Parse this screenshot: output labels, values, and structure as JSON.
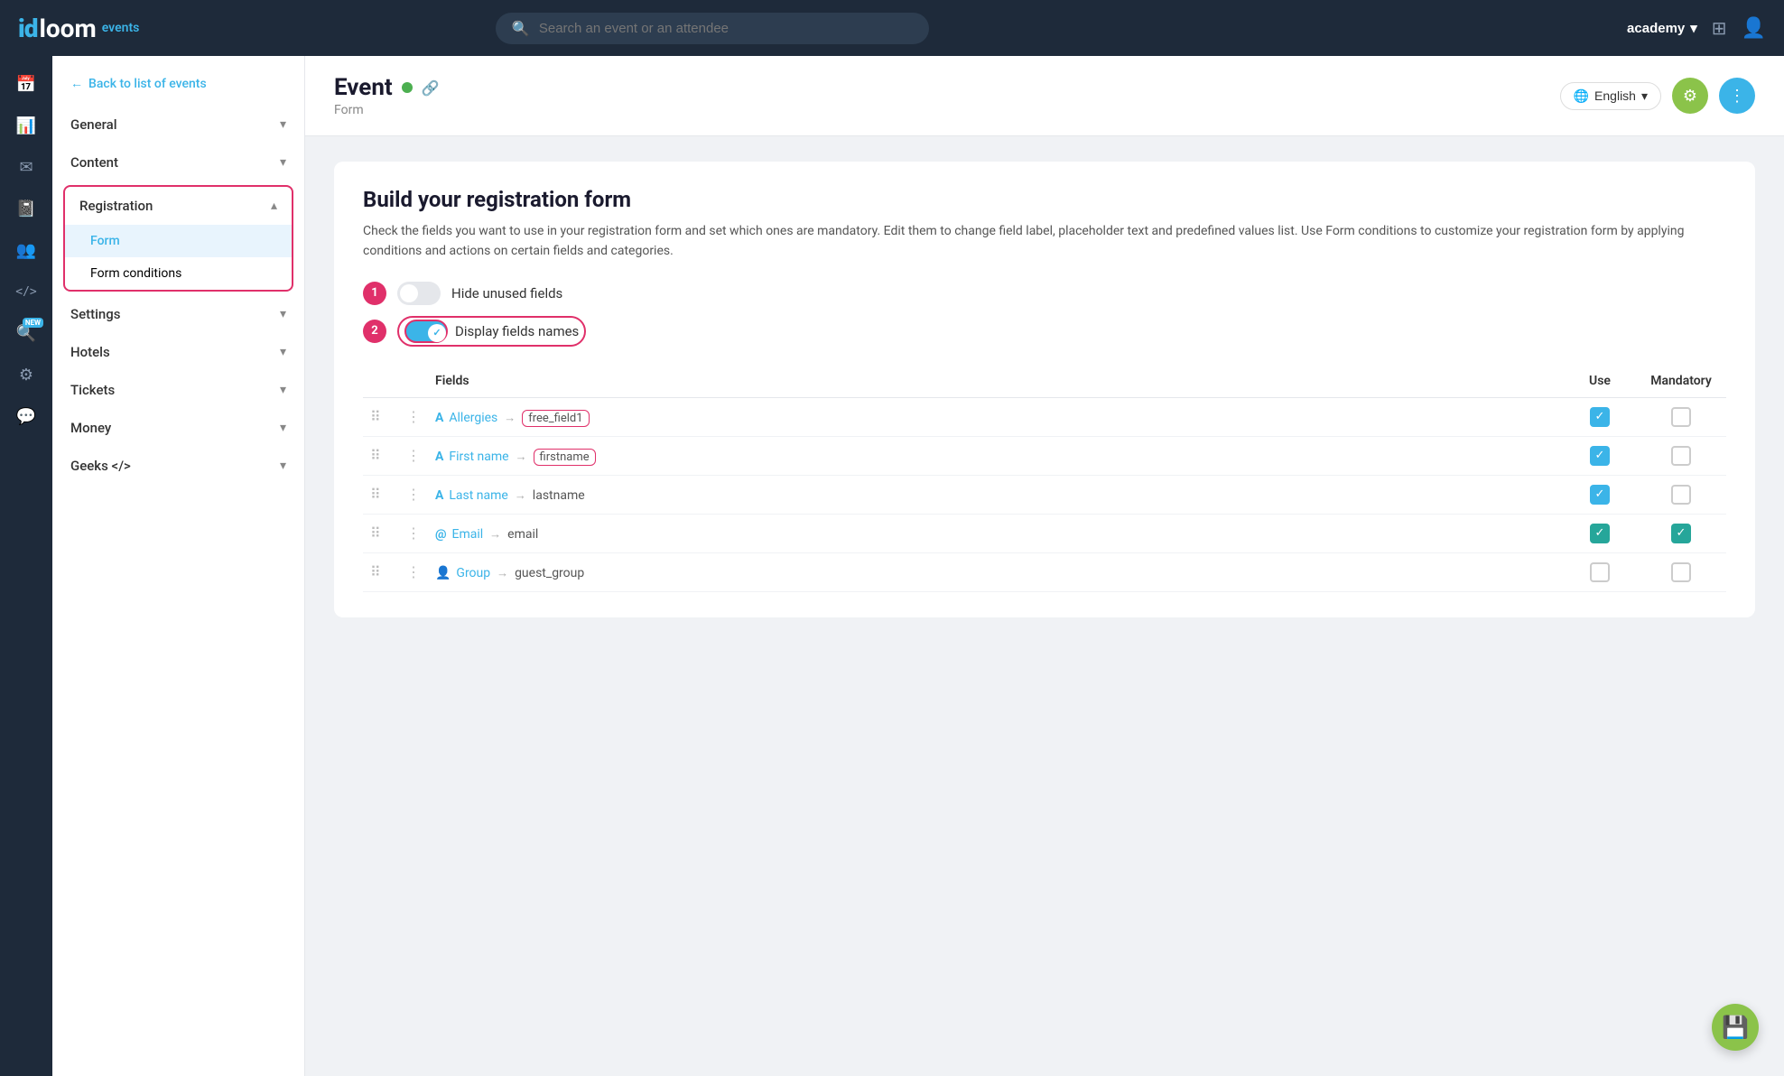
{
  "app": {
    "logo_id": "id",
    "logo_loom": "loom",
    "logo_events": "events"
  },
  "topnav": {
    "search_placeholder": "Search an event or an attendee",
    "account_label": "academy",
    "dropdown_icon": "▾"
  },
  "sidebar_icons": [
    {
      "name": "calendar-icon",
      "symbol": "📅",
      "active": false
    },
    {
      "name": "chart-icon",
      "symbol": "📊",
      "active": false
    },
    {
      "name": "email-icon",
      "symbol": "✉",
      "active": false
    },
    {
      "name": "book-icon",
      "symbol": "📓",
      "active": false
    },
    {
      "name": "users-icon",
      "symbol": "👥",
      "active": false
    },
    {
      "name": "code-icon",
      "symbol": "</>",
      "active": false
    },
    {
      "name": "search-new-icon",
      "symbol": "🔍",
      "active": false,
      "badge": "NEW"
    },
    {
      "name": "settings-icon",
      "symbol": "⚙",
      "active": false
    },
    {
      "name": "help-icon",
      "symbol": "💬",
      "active": false
    }
  ],
  "left_sidebar": {
    "back_link": "Back to list of events",
    "sections": [
      {
        "label": "General",
        "expanded": false,
        "items": []
      },
      {
        "label": "Content",
        "expanded": false,
        "items": []
      },
      {
        "label": "Registration",
        "expanded": true,
        "active": true,
        "items": [
          {
            "label": "Form",
            "active": true
          },
          {
            "label": "Form conditions",
            "active": false
          }
        ]
      },
      {
        "label": "Settings",
        "expanded": false,
        "items": []
      },
      {
        "label": "Hotels",
        "expanded": false,
        "items": []
      },
      {
        "label": "Tickets",
        "expanded": false,
        "items": []
      },
      {
        "label": "Money",
        "expanded": false,
        "items": []
      },
      {
        "label": "Geeks </>",
        "expanded": false,
        "items": []
      }
    ]
  },
  "event_header": {
    "title": "Event",
    "status": "live",
    "subtitle": "Form",
    "language_label": "English",
    "settings_label": "⚙",
    "more_label": "⋮"
  },
  "form_builder": {
    "title": "Build your registration form",
    "description": "Check the fields you want to use in your registration form and set which ones are mandatory. Edit them to change field label, placeholder text and predefined values list. Use Form conditions to customize your registration form by applying conditions and actions on certain fields and categories.",
    "toggle_hide_unused": {
      "label": "Hide unused fields",
      "state": "off"
    },
    "toggle_display_fields": {
      "label": "Display fields names",
      "state": "on"
    },
    "table": {
      "headers": [
        "",
        "",
        "Fields",
        "",
        "Use",
        "Mandatory"
      ],
      "rows": [
        {
          "drag": true,
          "menu": true,
          "type_icon": "A",
          "name": "Allergies",
          "arrow": "→",
          "key": "free_field1",
          "key_highlight": true,
          "use": true,
          "mandatory": false
        },
        {
          "drag": true,
          "menu": true,
          "type_icon": "A",
          "name": "First name",
          "arrow": "→",
          "key": "firstname",
          "key_highlight": true,
          "use": true,
          "mandatory": false
        },
        {
          "drag": true,
          "menu": true,
          "type_icon": "A",
          "name": "Last name",
          "arrow": "→",
          "key": "lastname",
          "key_highlight": false,
          "use": true,
          "mandatory": false
        },
        {
          "drag": true,
          "menu": true,
          "type_icon": "@",
          "name": "Email",
          "arrow": "→",
          "key": "email",
          "key_highlight": false,
          "use": true,
          "mandatory": true
        },
        {
          "drag": true,
          "menu": true,
          "type_icon": "👤",
          "name": "Group",
          "arrow": "→",
          "key": "guest_group",
          "key_highlight": false,
          "use": false,
          "mandatory": false
        }
      ]
    }
  },
  "steps": {
    "step1": "1",
    "step2": "2"
  }
}
